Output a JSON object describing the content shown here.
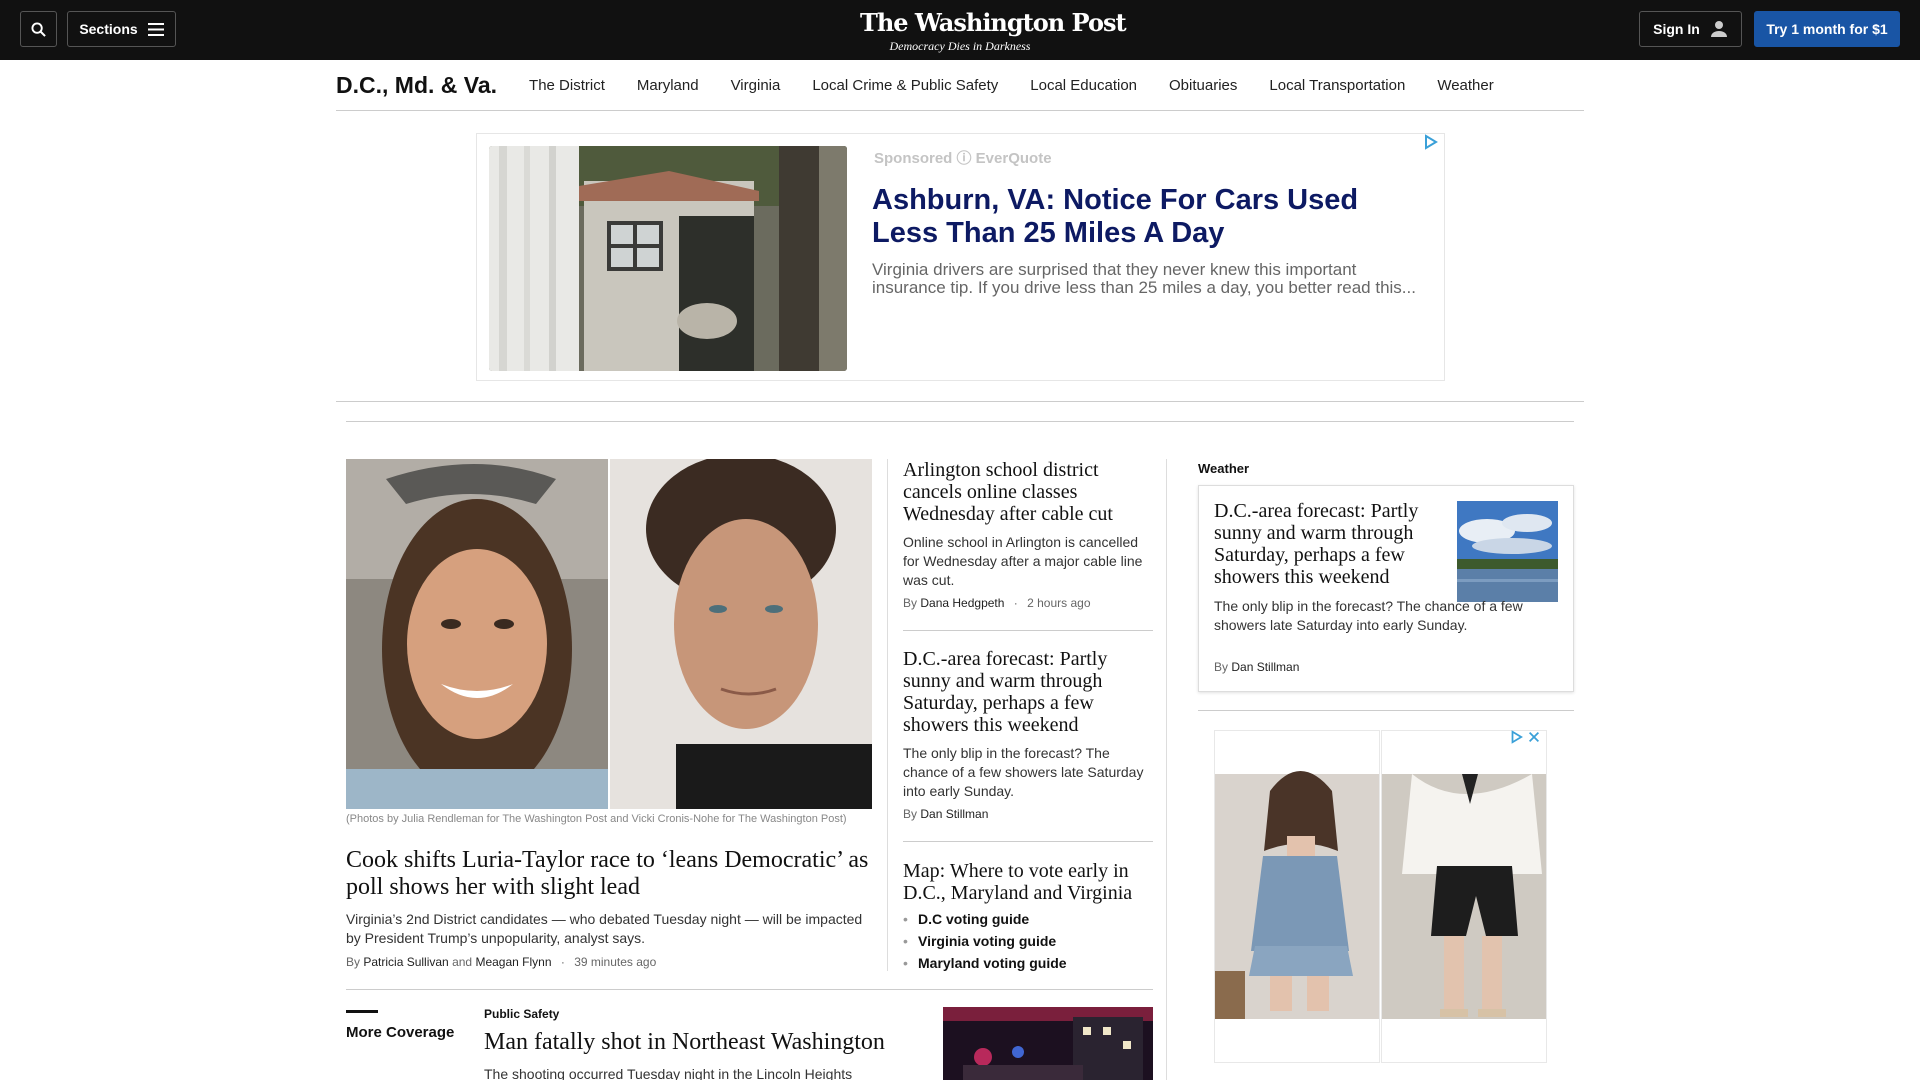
{
  "header": {
    "logo": "The Washington Post",
    "tagline": "Democracy Dies in Darkness",
    "sections_label": "Sections",
    "signin_label": "Sign In",
    "subscribe_label": "Try 1 month for $1",
    "icons": [
      "search-icon",
      "hamburger-menu-icon",
      "user-icon"
    ]
  },
  "section_nav": {
    "title": "D.C., Md. & Va.",
    "links": [
      "The District",
      "Maryland",
      "Virginia",
      "Local Crime & Public Safety",
      "Local Education",
      "Obituaries",
      "Local Transportation",
      "Weather"
    ]
  },
  "sponsored_ad": {
    "sponsored_label": "Sponsored ⓘ EverQuote",
    "headline": "Ashburn, VA: Notice For Cars Used Less Than 25 Miles A Day",
    "text": "Virginia drivers are surprised that they never knew this important insurance tip. If you drive less than 25 miles a day, you better read this...",
    "colors": {
      "headline": "#0d1a63",
      "sponsored": "#c4c4c4"
    }
  },
  "main_story": {
    "caption": "(Photos by Julia Rendleman for The Washington Post and Vicki Cronis-Nohe for The Washington Post)",
    "headline": "Cook shifts Luria-Taylor race to ‘leans Democratic’ as poll shows her with slight lead",
    "blurb": "Virginia’s 2nd District candidates — who debated Tuesday night — will be impacted by President Trump’s unpopularity, analyst says.",
    "by": "By",
    "author1": "Patricia Sullivan",
    "and": "and",
    "author2": "Meagan Flynn",
    "time": "39 minutes ago"
  },
  "mid_stories": [
    {
      "headline": "Arlington school district cancels online classes Wednesday after cable cut",
      "blurb": "Online school in Arlington is cancelled for Wednesday after a major cable line was cut.",
      "by": "By",
      "author": "Dana Hedgpeth",
      "time": "2 hours ago"
    },
    {
      "headline": "D.C.-area forecast: Partly sunny and warm through Saturday, perhaps a few showers this weekend",
      "blurb": "The only blip in the forecast? The chance of a few showers late Saturday into early Sunday.",
      "by": "By",
      "author": "Dan Stillman"
    },
    {
      "headline": "Map: Where to vote early in D.C., Maryland and Virginia",
      "guides": [
        "D.C voting guide",
        "Virginia voting guide",
        "Maryland voting guide"
      ]
    }
  ],
  "weather": {
    "label": "Weather",
    "headline": "D.C.-area forecast: Partly sunny and warm through Saturday, perhaps a few showers this weekend",
    "blurb": "The only blip in the forecast? The chance of a few showers late Saturday into early Sunday.",
    "by": "By",
    "author": "Dan Stillman"
  },
  "more_coverage": {
    "label": "More Coverage",
    "kicker": "Public Safety",
    "headline": "Man fatally shot in Northeast Washington",
    "blurb": "The shooting occurred Tuesday night in the Lincoln Heights"
  },
  "colors": {
    "topbar": "#111111",
    "subscribe_button": "#1955a5"
  }
}
